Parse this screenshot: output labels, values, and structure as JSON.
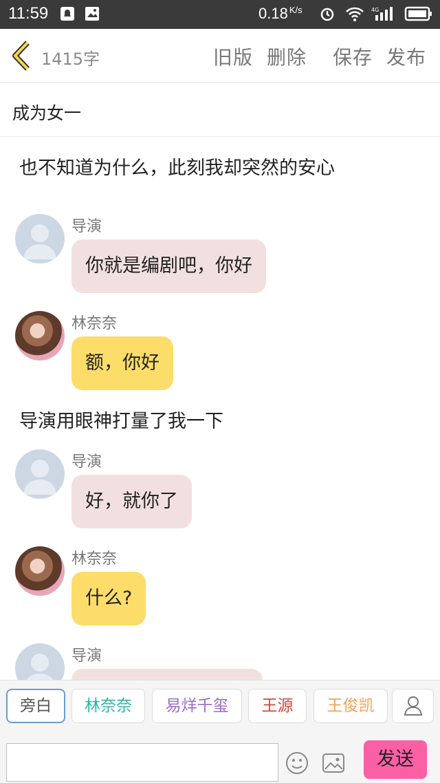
{
  "status_bar": {
    "time": "11:59",
    "speed": "0.18",
    "speed_unit": "K/s",
    "network": "4G"
  },
  "header": {
    "word_count": "1415字",
    "actions": {
      "old_version": "旧版",
      "delete": "删除",
      "save": "保存",
      "publish": "发布"
    }
  },
  "title": "成为女一",
  "narrations": [
    "也不知道为什么，此刻我却突然的安心",
    "导演用眼神打量了我一下"
  ],
  "messages": [
    {
      "speaker": "导演",
      "text": "你就是编剧吧，你好"
    },
    {
      "speaker": "林奈奈",
      "text": "额，你好"
    },
    {
      "speaker": "导演",
      "text": "好，就你了"
    },
    {
      "speaker": "林奈奈",
      "text": "什么?"
    },
    {
      "speaker": "导演",
      "text": ""
    }
  ],
  "roles": [
    {
      "label": "旁白",
      "color": "#555555"
    },
    {
      "label": "林奈奈",
      "color": "#2fb2a6"
    },
    {
      "label": "易烊千玺",
      "color": "#9b6cc8"
    },
    {
      "label": "王源",
      "color": "#d2473a"
    },
    {
      "label": "王俊凯",
      "color": "#f0a35c"
    }
  ],
  "composer": {
    "input_value": "",
    "placeholder": "",
    "send_label": "发送",
    "send_color": "#fb60a5"
  },
  "icons": [
    "back-chevron-icon",
    "emoji-icon",
    "image-icon",
    "person-icon"
  ]
}
